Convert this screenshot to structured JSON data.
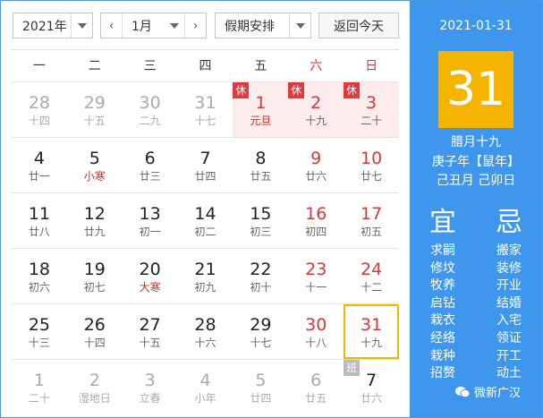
{
  "toolbar": {
    "year": "2021年",
    "month": "1月",
    "holiday": "假期安排",
    "today": "返回今天",
    "prev_arrow": "‹",
    "next_arrow": "›"
  },
  "weekdays": [
    "一",
    "二",
    "三",
    "四",
    "五",
    "六",
    "日"
  ],
  "weeks": [
    [
      {
        "d": "28",
        "l": "十四",
        "other": true
      },
      {
        "d": "29",
        "l": "十五",
        "other": true
      },
      {
        "d": "30",
        "l": "二九",
        "other": true
      },
      {
        "d": "31",
        "l": "十七",
        "other": true
      },
      {
        "d": "1",
        "l": "元旦",
        "tag": "休",
        "hol": true,
        "we": true,
        "red": true
      },
      {
        "d": "2",
        "l": "十九",
        "tag": "休",
        "hol": true,
        "we": true
      },
      {
        "d": "3",
        "l": "二十",
        "tag": "休",
        "hol": true,
        "we": true
      }
    ],
    [
      {
        "d": "4",
        "l": "廿一"
      },
      {
        "d": "5",
        "l": "小寒",
        "red": true
      },
      {
        "d": "6",
        "l": "廿三"
      },
      {
        "d": "7",
        "l": "廿四"
      },
      {
        "d": "8",
        "l": "廿五"
      },
      {
        "d": "9",
        "l": "廿六",
        "we": true
      },
      {
        "d": "10",
        "l": "廿七",
        "we": true
      }
    ],
    [
      {
        "d": "11",
        "l": "廿八"
      },
      {
        "d": "12",
        "l": "廿九"
      },
      {
        "d": "13",
        "l": "初一"
      },
      {
        "d": "14",
        "l": "初二"
      },
      {
        "d": "15",
        "l": "初三"
      },
      {
        "d": "16",
        "l": "初四",
        "we": true
      },
      {
        "d": "17",
        "l": "初五",
        "we": true
      }
    ],
    [
      {
        "d": "18",
        "l": "初六"
      },
      {
        "d": "19",
        "l": "初七"
      },
      {
        "d": "20",
        "l": "大寒",
        "red": true
      },
      {
        "d": "21",
        "l": "初九"
      },
      {
        "d": "22",
        "l": "初十"
      },
      {
        "d": "23",
        "l": "十一",
        "we": true
      },
      {
        "d": "24",
        "l": "十二",
        "we": true
      }
    ],
    [
      {
        "d": "25",
        "l": "十三"
      },
      {
        "d": "26",
        "l": "十四"
      },
      {
        "d": "27",
        "l": "十五"
      },
      {
        "d": "28",
        "l": "十六"
      },
      {
        "d": "29",
        "l": "十七"
      },
      {
        "d": "30",
        "l": "十八",
        "we": true
      },
      {
        "d": "31",
        "l": "十九",
        "we": true,
        "selected": true
      }
    ],
    [
      {
        "d": "1",
        "l": "二十",
        "other": true
      },
      {
        "d": "2",
        "l": "湿地日",
        "other": true
      },
      {
        "d": "3",
        "l": "立春",
        "other": true
      },
      {
        "d": "4",
        "l": "小年",
        "other": true
      },
      {
        "d": "5",
        "l": "廿四",
        "other": true
      },
      {
        "d": "6",
        "l": "廿五",
        "other": true
      },
      {
        "d": "7",
        "l": "廿六",
        "other": true,
        "tag": "班",
        "work": true
      }
    ]
  ],
  "panel": {
    "date": "2021-01-31",
    "day": "31",
    "lunar": "腊月十九",
    "ganzhi_year": "庚子年【鼠年】",
    "ganzhi_month_day": "己丑月 己卯日",
    "yi_title": "宜",
    "ji_title": "忌",
    "yi": [
      "求嗣",
      "修坟",
      "牧养",
      "启钻",
      "栽衣",
      "经络",
      "栽种",
      "招赘"
    ],
    "ji": [
      "搬家",
      "装修",
      "开业",
      "结婚",
      "入宅",
      "领证",
      "开工",
      "动土"
    ]
  },
  "watermark": "微新广汉",
  "colors": {
    "accent": "#3f97ed",
    "highlight": "#f5b400",
    "holiday_red": "#e4393c",
    "weekend_text": "#d8383a"
  }
}
